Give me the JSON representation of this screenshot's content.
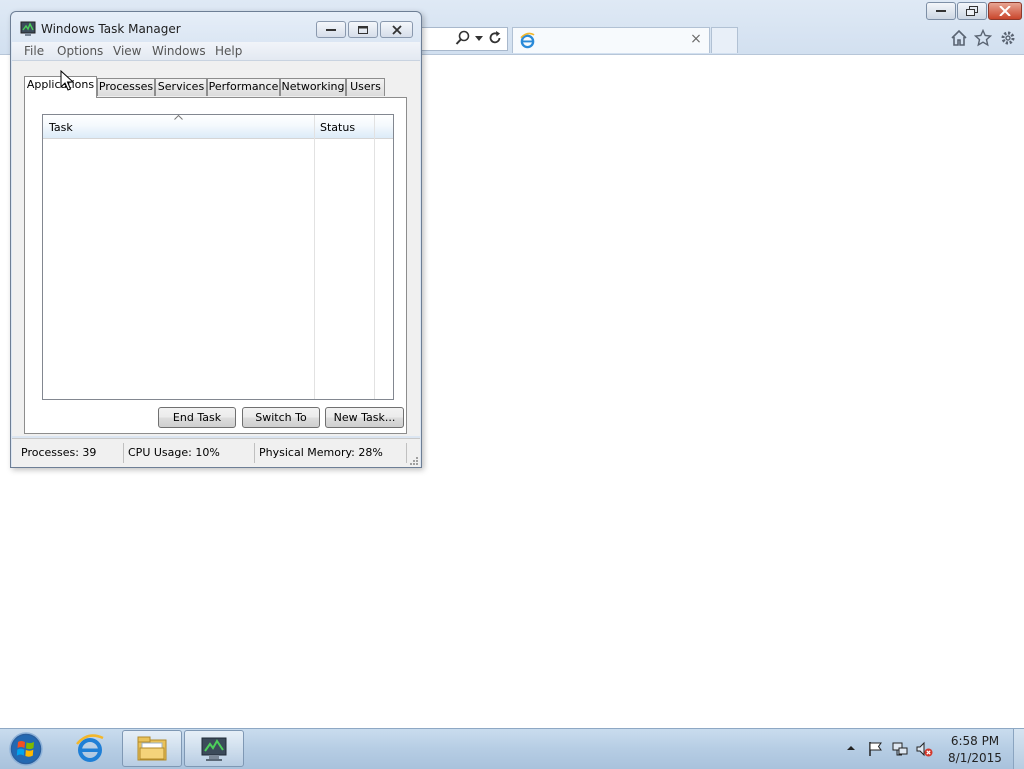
{
  "browser": {
    "tab_title": "",
    "icons": [
      "search-icon",
      "dropdown-arrow-icon",
      "refresh-icon",
      "internet-explorer-icon",
      "close-icon",
      "home-icon",
      "favorites-star-icon",
      "tools-gear-icon"
    ],
    "tab_close": "×"
  },
  "task_manager": {
    "title": "Windows Task Manager",
    "menu": [
      "File",
      "Options",
      "View",
      "Windows",
      "Help"
    ],
    "tabs": [
      "Applications",
      "Processes",
      "Services",
      "Performance",
      "Networking",
      "Users"
    ],
    "active_tab": "Applications",
    "columns": [
      "Task",
      "Status"
    ],
    "tasks": [],
    "buttons": {
      "end_task": "End Task",
      "switch_to": "Switch To",
      "new_task": "New Task..."
    },
    "status": {
      "processes": "Processes: 39",
      "cpu": "CPU Usage: 10%",
      "memory": "Physical Memory: 28%"
    }
  },
  "taskbar": {
    "items": [
      "start-orb-icon",
      "internet-explorer-icon",
      "windows-explorer-icon",
      "task-manager-icon"
    ],
    "tray_icons": [
      "show-hidden-icons-arrow",
      "action-center-flag-icon",
      "network-icon",
      "volume-muted-icon"
    ],
    "clock": {
      "time": "6:58 PM",
      "date": "8/1/2015"
    }
  },
  "colors": {
    "window_frame": "#d8e4f2",
    "taskbar": "#b6cde4",
    "close_button": "#c9462c"
  }
}
